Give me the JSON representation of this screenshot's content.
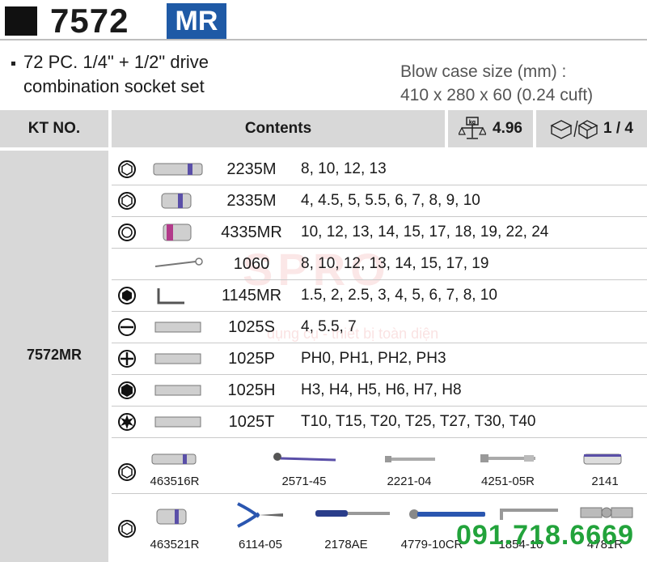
{
  "header": {
    "model": "7572",
    "badge": "MR"
  },
  "description": {
    "line1": "72 PC. 1/4\" + 1/2\" drive",
    "line2": "combination socket set"
  },
  "blow_case": {
    "line1": "Blow case size (mm) :",
    "line2": "410 x 280 x 60 (0.24 cuft)"
  },
  "table_header": {
    "kt_no": "KT NO.",
    "contents": "Contents",
    "weight": "4.96",
    "weight_unit_icon": "kg",
    "box": "1 / 4"
  },
  "kt_value": "7572MR",
  "rows": [
    {
      "symbol": "hex-socket",
      "code": "2235M",
      "sizes": "8, 10, 12, 13"
    },
    {
      "symbol": "hex-socket",
      "code": "2335M",
      "sizes": "4, 4.5, 5, 5.5, 6, 7, 8, 9, 10"
    },
    {
      "symbol": "bi-hex-socket",
      "code": "4335MR",
      "sizes": "10, 12, 13, 14, 15, 17, 18, 19, 22, 24"
    },
    {
      "symbol": "none",
      "code": "1060",
      "sizes": "8, 10, 12, 13, 14, 15, 17, 19"
    },
    {
      "symbol": "hex-key",
      "code": "1145MR",
      "sizes": "1.5, 2, 2.5, 3, 4, 5, 6, 7, 8, 10"
    },
    {
      "symbol": "slotted",
      "code": "1025S",
      "sizes": "4, 5.5, 7"
    },
    {
      "symbol": "phillips",
      "code": "1025P",
      "sizes": "PH0, PH1, PH2, PH3"
    },
    {
      "symbol": "hex-bit",
      "code": "1025H",
      "sizes": "H3, H4, H5, H6, H7, H8"
    },
    {
      "symbol": "torx",
      "code": "1025T",
      "sizes": "T10, T15, T20, T25, T27, T30, T40"
    }
  ],
  "accessories_row1": [
    "463516R",
    "2571-45",
    "2221-04",
    "4251-05R",
    "2141"
  ],
  "accessories_row2": [
    "463521R",
    "6114-05",
    "2178AE",
    "4779-10CR",
    "1854-10",
    "4781R"
  ],
  "watermark": {
    "brand": "SPRO",
    "tagline": "dụng cụ - thiết bị toàn diện"
  },
  "phone": "091.718.6669",
  "colors": {
    "badge": "#1f5aa6",
    "header_gray": "#d8d8d8",
    "phone": "#22a33b"
  }
}
